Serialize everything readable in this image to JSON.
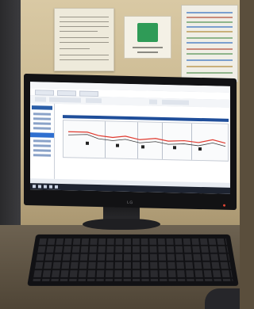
{
  "scene": {
    "monitor_brand": "LG"
  },
  "colors": {
    "wall": "#d9c9a4",
    "desk": "#5a4e3c",
    "accent_blue": "#1f4e9a",
    "sign_green": "#2f9b57",
    "trace_red": "#e03a2f"
  },
  "icons": [
    "start-icon",
    "taskbar-app-icon",
    "calculator-icon"
  ]
}
